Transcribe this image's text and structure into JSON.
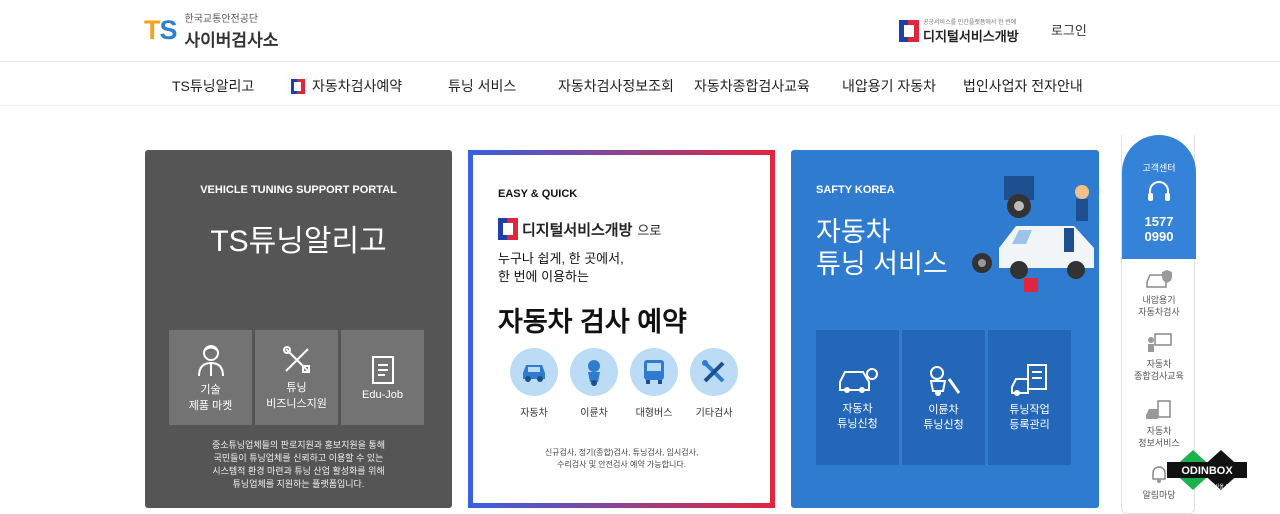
{
  "header": {
    "org_sub": "한국교통안전공단",
    "site_name": "사이버검사소",
    "logo_t": "T",
    "logo_s": "S",
    "digital_sub": "공공서비스를 민간플랫폼에서 한 번에",
    "digital_name": "디지털서비스개방",
    "login": "로그인"
  },
  "nav": {
    "items": [
      "TS튜닝알리고",
      "자동차검사예약",
      "튜닝 서비스",
      "자동차검사정보조회",
      "자동차종합검사교육",
      "내압용기 자동차",
      "법인사업자 전자안내"
    ]
  },
  "panel1": {
    "label": "VEHICLE TUNING SUPPORT PORTAL",
    "title": "TS튜닝알리고",
    "tiles": [
      {
        "line1": "기술",
        "line2": "제품 마켓",
        "icon": "worker-icon"
      },
      {
        "line1": "튜닝",
        "line2": "비즈니스지원",
        "icon": "tools-icon"
      },
      {
        "line1": "Edu-Job",
        "line2": "",
        "icon": "document-icon"
      }
    ],
    "desc1": "중소튜닝업체들의 판로지원과 홍보지원을 통해",
    "desc2": "국민들이 튜닝업체를 신뢰하고 이용할 수 있는",
    "desc3": "시스템적 환경 마련과 튜닝 산업 활성화를 위해",
    "desc4": "튜닝업체를 지원하는 플랫폼입니다."
  },
  "panel2": {
    "label": "EASY & QUICK",
    "brand": "디지털서비스개방",
    "brand_suffix": "으로",
    "line1": "누구나 쉽게, 한 곳에서,",
    "line2": "한 번에 이용하는",
    "big": "자동차 검사 예약",
    "circles": [
      {
        "label": "자동차",
        "icon": "car-icon"
      },
      {
        "label": "이륜차",
        "icon": "scooter-icon"
      },
      {
        "label": "대형버스",
        "icon": "bus-icon"
      },
      {
        "label": "기타검사",
        "icon": "wrench-icon"
      }
    ],
    "desc1": "신규검사, 정기(종합)검사, 튜닝검사, 임시검사,",
    "desc2": "수리검사 및 안전검사 예약 가능합니다."
  },
  "panel3": {
    "label": "SAFTY KOREA",
    "title1": "자동차",
    "title2": "튜닝 서비스",
    "tiles": [
      {
        "line1": "자동차",
        "line2": "튜닝신청",
        "icon": "car-gear-icon"
      },
      {
        "line1": "이륜차",
        "line2": "튜닝신청",
        "icon": "scooter-wrench-icon"
      },
      {
        "line1": "튜닝작업",
        "line2": "등록관리",
        "icon": "checklist-car-icon"
      }
    ]
  },
  "quick": {
    "title": "고객센터",
    "phone1": "1577",
    "phone2": "0990",
    "items": [
      {
        "line1": "내압용기",
        "line2": "자동차검사"
      },
      {
        "line1": "자동차",
        "line2": "종합검사교육"
      },
      {
        "line1": "자동차",
        "line2": "정보서비스"
      },
      {
        "line1": "알림마당",
        "line2": ""
      }
    ]
  },
  "badge": {
    "name": "ODINBOX",
    "tagline": "혁신을 이룹니다"
  },
  "colors": {
    "accent_blue": "#2f7bd0",
    "dark_panel": "#555555",
    "brand_red": "#e0263e",
    "brand_navy": "#1f3fa8"
  }
}
